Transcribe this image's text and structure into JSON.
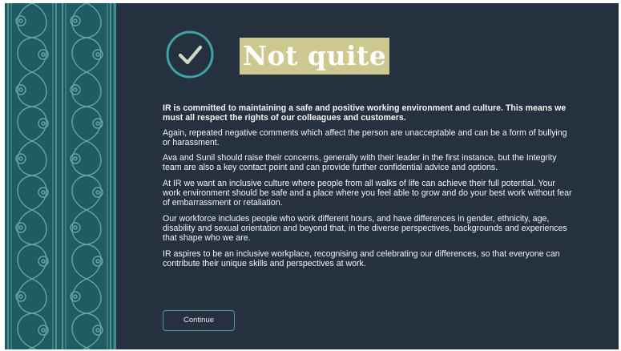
{
  "feedback": {
    "title": "Not quite",
    "icon": "check-icon"
  },
  "content": {
    "paragraphs": [
      "IR is committed to maintaining a safe and positive working environment and culture. This means we must all respect the rights of our colleagues and customers.",
      "Again, repeated negative comments which affect the person are unacceptable and can be a form of bullying or harassment.",
      "Ava and Sunil should raise their concerns, generally with their leader in the first instance, but the Integrity team are also a key contact point and can provide further confidential advice and options.",
      "At IR we want an inclusive culture where people from all walks of life can achieve their full potential. Your work environment should be safe and a place where you feel able to grow and do your best work without fear of embarrassment or retaliation.",
      "Our workforce includes people who work different hours, and have differences in gender, ethnicity, age, disability and sexual orientation and beyond that, in the diverse perspectives, backgrounds and experiences that shape who we are.",
      "IR aspires to be an inclusive workplace, recognising and celebrating our differences, so that everyone can contribute their unique skills and perspectives at work."
    ]
  },
  "actions": {
    "continue_label": "Continue"
  },
  "colors": {
    "background": "#25313f",
    "accent": "#3fa3a6",
    "title_highlight": "#cdc88f",
    "pattern": "#1f5f67"
  }
}
